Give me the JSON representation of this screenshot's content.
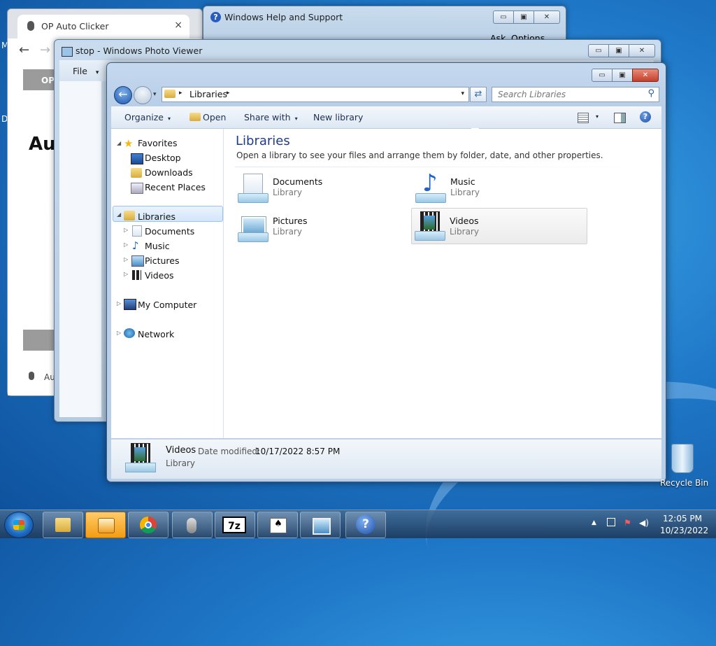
{
  "desktop": {
    "recycle_bin_label": "Recycle Bin",
    "edge_letters": [
      "M",
      "D"
    ]
  },
  "chrome_window": {
    "tab_title": "OP Auto Clicker",
    "tab_close": "×",
    "back": "←",
    "forward": "→",
    "op_label": "OP",
    "heading_fragment": "Au",
    "bottom_fragment": "Au"
  },
  "help_window": {
    "title": "Windows Help and Support",
    "ask_label": "Ask",
    "options_label": "Options"
  },
  "photo_viewer": {
    "title": "stop - Windows Photo Viewer",
    "file_menu": "File",
    "file_caret": "▾"
  },
  "explorer": {
    "caption_buttons": [
      "▭",
      "▣",
      "✕"
    ],
    "address": {
      "folder_arrow": "▸",
      "crumb": "Libraries",
      "crumb_arrow": "▸",
      "dropdown": "▾"
    },
    "refresh": "⇄",
    "search": {
      "placeholder": "Search Libraries",
      "icon": "⚲"
    },
    "toolbar": {
      "organize": "Organize",
      "open": "Open",
      "share_with": "Share with",
      "new_library": "New library",
      "caret": "▾",
      "help": "?"
    },
    "nav": {
      "favorites": "Favorites",
      "favorites_items": [
        "Desktop",
        "Downloads",
        "Recent Places"
      ],
      "libraries": "Libraries",
      "libraries_items": [
        "Documents",
        "Music",
        "Pictures",
        "Videos"
      ],
      "my_computer": "My Computer",
      "network": "Network",
      "expanded": "◢",
      "collapsed": "▷"
    },
    "main": {
      "heading": "Libraries",
      "subtitle": "Open a library to see your files and arrange them by folder, date, and other properties.",
      "items": [
        {
          "name": "Documents",
          "type": "Library"
        },
        {
          "name": "Music",
          "type": "Library"
        },
        {
          "name": "Pictures",
          "type": "Library"
        },
        {
          "name": "Videos",
          "type": "Library"
        }
      ]
    },
    "details": {
      "name": "Videos",
      "modified_label": "Date modified:",
      "modified_value": "10/17/2022 8:57 PM",
      "type": "Library"
    }
  },
  "taskbar": {
    "pinned": [
      "explorer-icon",
      "media-player-icon",
      "chrome-icon",
      "mouse-icon",
      "7zip-icon",
      "solitaire-icon",
      "photo-viewer-icon",
      "help-icon"
    ],
    "sevenzip_label": "7z",
    "help_label": "?",
    "tray_arrow": "▲",
    "tray_icons": [
      "network-icon",
      "action-center-icon",
      "volume-icon"
    ],
    "time": "12:05 PM",
    "date": "10/23/2022"
  },
  "colors": {
    "selection": "#d3e6fa",
    "heading_blue": "#1e3c8c",
    "taskbar_active": "#f39c12"
  }
}
